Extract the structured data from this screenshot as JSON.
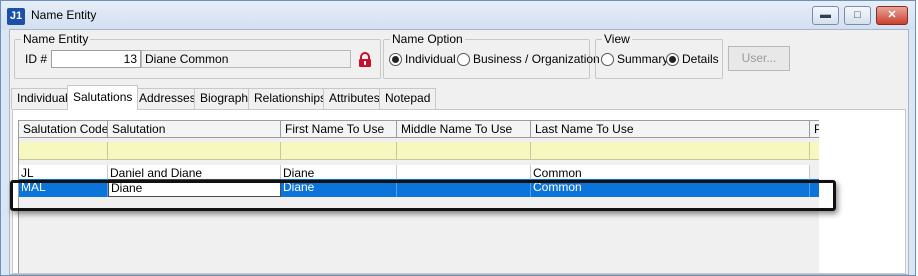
{
  "window": {
    "app_icon_text": "J1",
    "title": "Name Entity",
    "minimize_icon": "minimize-icon",
    "maximize_icon": "maximize-icon",
    "close_icon": "close-icon"
  },
  "name_entity": {
    "group_label": "Name Entity",
    "id_label": "ID #",
    "id_value": "13",
    "name_value": "Diane Common",
    "lock_icon": "lock-icon",
    "lock_color": "#c8102e"
  },
  "name_option": {
    "group_label": "Name Option",
    "options": [
      "Individual",
      "Business / Organization"
    ],
    "selected": "Individual"
  },
  "view": {
    "group_label": "View",
    "options": [
      "Summary",
      "Details"
    ],
    "selected": "Details"
  },
  "user_button": "User...",
  "tabs": [
    "Individual",
    "Salutations",
    "Addresses",
    "Biograph",
    "Relationships",
    "Attributes",
    "Notepad"
  ],
  "active_tab": "Salutations",
  "grid": {
    "columns": [
      "Salutation Code",
      "Salutation",
      "First Name To Use",
      "Middle Name To Use",
      "Last Name To Use",
      "Pr"
    ],
    "rows": [
      [
        "JL",
        "Daniel and Diane",
        "Diane",
        "",
        "Common"
      ],
      [
        "MAL",
        "Diane",
        "Diane",
        "",
        "Common"
      ]
    ],
    "selected_row_color": "#0a74da",
    "filter_row_color": "#f7f7c0"
  }
}
